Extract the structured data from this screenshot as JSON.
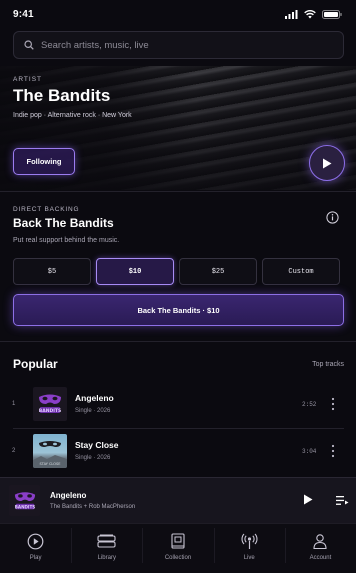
{
  "status": {
    "time": "9:41"
  },
  "search": {
    "placeholder": "Search artists, music, live"
  },
  "hero": {
    "eyebrow": "ARTIST",
    "title": "The Bandits",
    "genres": "Indie pop · Alternative rock · New York",
    "follow_label": "Following"
  },
  "backing": {
    "eyebrow": "DIRECT BACKING",
    "title": "Back The Bandits",
    "subtitle": "Put real support behind the music.",
    "amounts": [
      "$5",
      "$10",
      "$25",
      "Custom"
    ],
    "selected_amount": "$10",
    "cta_label": "Back The Bandits · $10"
  },
  "popular": {
    "title": "Popular",
    "link": "Top tracks",
    "tracks": [
      {
        "num": "1",
        "title": "Angeleno",
        "meta": "Single · 2026",
        "duration": "2:52",
        "art": "mask-logo"
      },
      {
        "num": "2",
        "title": "Stay Close",
        "meta": "Single · 2026",
        "duration": "3:04",
        "art": "sky-mask"
      }
    ]
  },
  "now_playing": {
    "title": "Angeleno",
    "artist": "The Bandits + Rob MacPherson"
  },
  "tabs": [
    {
      "label": "Play",
      "icon": "play-circle-icon"
    },
    {
      "label": "Library",
      "icon": "library-stack-icon"
    },
    {
      "label": "Collection",
      "icon": "collection-book-icon"
    },
    {
      "label": "Live",
      "icon": "live-broadcast-icon"
    },
    {
      "label": "Account",
      "icon": "account-person-icon"
    }
  ],
  "colors": {
    "accent": "#9b7cf0",
    "background": "#0b0a10"
  }
}
